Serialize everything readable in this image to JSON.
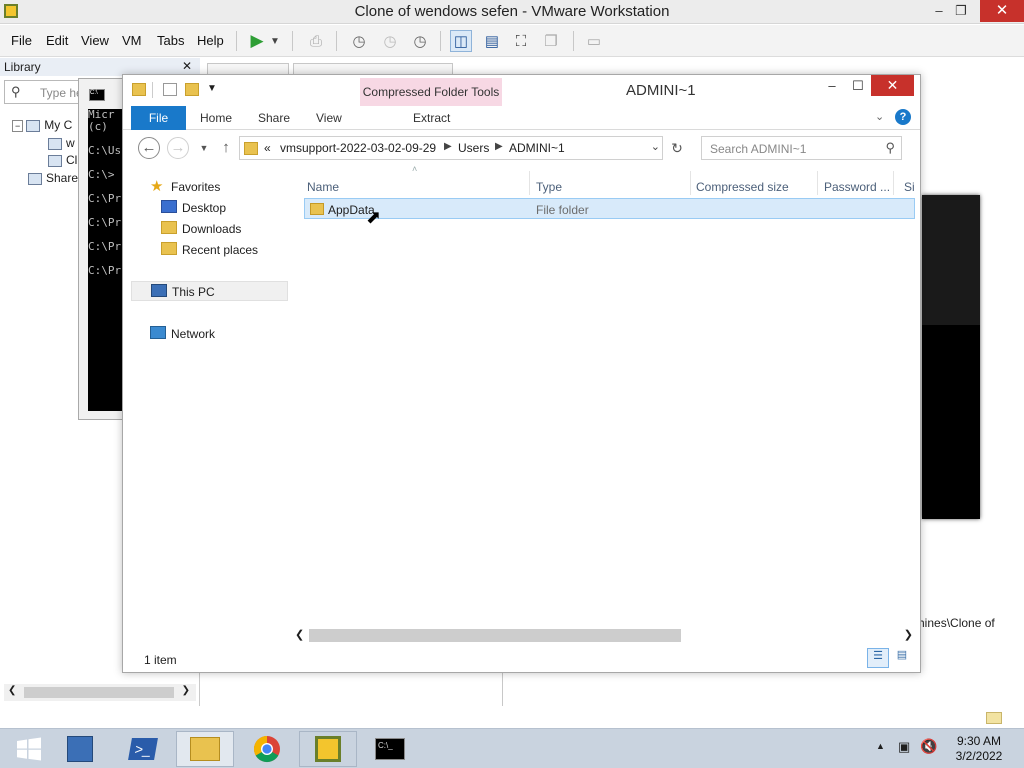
{
  "vm": {
    "title": "Clone of wendows sefen - VMware Workstation",
    "menus": [
      "File",
      "Edit",
      "View",
      "VM",
      "Tabs",
      "Help"
    ],
    "library": {
      "title": "Library",
      "search_placeholder": "Type he",
      "tree": [
        "My C",
        "w",
        "Cl",
        "Share"
      ]
    },
    "guest_path_fragment": "hines\\Clone of"
  },
  "cmd": {
    "lines": [
      "Micr",
      "(c) ",
      "",
      "C:\\Us",
      "",
      "C:\\>",
      "",
      "C:\\Pr",
      "",
      "C:\\Pr",
      "",
      "C:\\Pr",
      "",
      "C:\\Pr"
    ]
  },
  "explorer": {
    "title": "ADMINI~1",
    "context_tab": "Compressed Folder Tools",
    "ribbon_tabs": [
      "File",
      "Home",
      "Share",
      "View"
    ],
    "context_subtab": "Extract",
    "address": {
      "overflow": "«",
      "crumbs": [
        "vmsupport-2022-03-02-09-29",
        "Users",
        "ADMINI~1"
      ]
    },
    "search_placeholder": "Search ADMINI~1",
    "nav": {
      "favorites": "Favorites",
      "desktop": "Desktop",
      "downloads": "Downloads",
      "recent": "Recent places",
      "this_pc": "This PC",
      "network": "Network"
    },
    "columns": [
      "Name",
      "Type",
      "Compressed size",
      "Password ...",
      "Si"
    ],
    "rows": [
      {
        "name": "AppData",
        "type": "File folder"
      }
    ],
    "status": "1 item"
  },
  "taskbar": {
    "time": "9:30 AM",
    "date": "3/2/2022"
  },
  "colors": {
    "accent": "#1979ca",
    "context_tab_bg": "#f7d8e4",
    "close_red": "#c7312b",
    "selection": "#d8eafa"
  }
}
